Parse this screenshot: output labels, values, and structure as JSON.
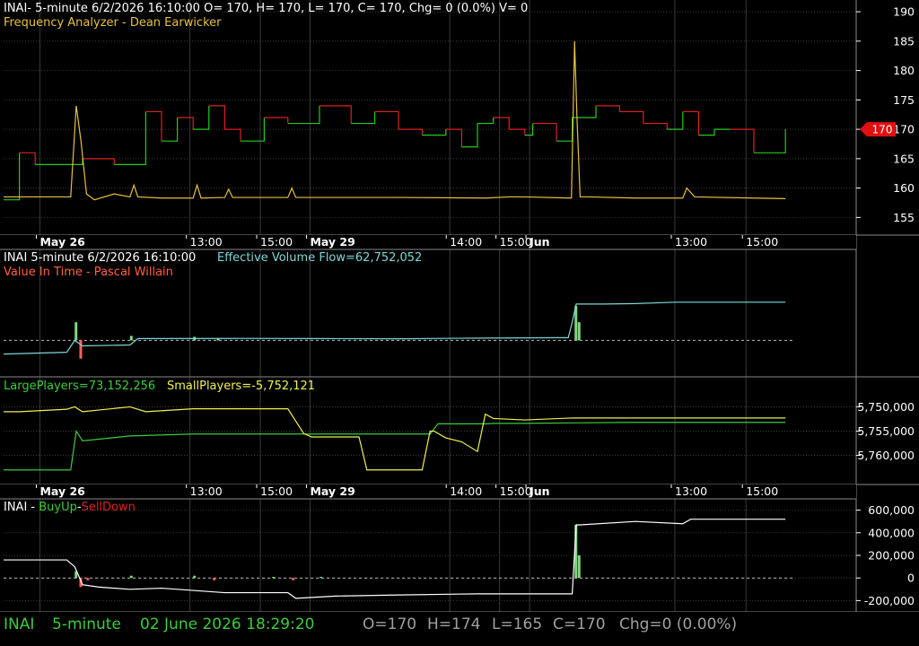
{
  "colors": {
    "background": "#000000",
    "grid": "#3a3a3a",
    "border": "#8a8a8a",
    "price_up": "#22cc22",
    "price_down": "#e02020",
    "freq": "#e8c040",
    "evf": "#7fd7d7",
    "large_players": "#3ccc3c",
    "small_players": "#f0f050",
    "buysell_line": "#ffffff",
    "buy_bar": "#7fd77f",
    "sell_bar": "#ff6060",
    "price_tag": "#e01010",
    "status_green": "#3ccc3c",
    "status_gray": "#a0a0a0"
  },
  "panel1": {
    "header": "INAI- 5-minute 6/2/2026 16:10:00 O= 170, H= 170, L= 170, C= 170, Chg= 0 (0.0%) V= 0",
    "subheader": "Frequency Analyzer - Dean Earwicker",
    "price_tag": "170"
  },
  "panel2": {
    "header_left": "INAI 5-minute  6/2/2026 16:10:00",
    "header_right": "Effective Volume Flow=62,752,052",
    "subheader": "Value In Time - Pascal Willain"
  },
  "panel3": {
    "large_label": "LargePlayers=73,152,256",
    "small_label": "SmallPlayers=-5,752,121"
  },
  "panel4": {
    "label_prefix": "INAI - ",
    "label_buy": "BuyUp",
    "label_sep": "-",
    "label_sell": "SellDown"
  },
  "time_axis": {
    "labels": [
      "May 26",
      "13:00",
      "15:00",
      "May 29",
      "14:00",
      "15:00",
      "Jun",
      "13:00",
      "15:00"
    ]
  },
  "status_bar": {
    "symbol": "INAI",
    "interval": "5-minute",
    "datetime": "02 June 2026 18:29:20",
    "open": "O=170",
    "high": "H=174",
    "low": "L=165",
    "close": "C=170",
    "change": "Chg=0 (0.00%)"
  },
  "chart_data": [
    {
      "type": "line",
      "panel": "price",
      "ylim": [
        152,
        192
      ],
      "yticks": [
        "190",
        "185",
        "180",
        "175",
        "170",
        "165",
        "160",
        "155"
      ],
      "series": [
        {
          "role": "price-steps",
          "x": [
            0,
            2,
            4,
            10,
            14,
            18,
            20,
            22,
            24,
            26,
            28,
            30,
            33,
            36,
            40,
            44,
            47,
            50,
            53,
            56,
            58,
            60,
            62,
            64,
            66,
            67,
            70,
            72,
            75,
            78,
            81,
            84,
            86,
            88,
            90,
            92,
            95,
            99
          ],
          "values": [
            158,
            166,
            164,
            165,
            164,
            173,
            168,
            172,
            170,
            174,
            170,
            168,
            172,
            171,
            174,
            171,
            173,
            170,
            169,
            170,
            167,
            171,
            172,
            170,
            169,
            171,
            168,
            172,
            174,
            173,
            171,
            170,
            173,
            169,
            170,
            170,
            166,
            170
          ]
        },
        {
          "role": "frequency-analyzer",
          "x": [
            0,
            8.5,
            9.2,
            9.8,
            10.5,
            11.5,
            14,
            16,
            16.5,
            17,
            20,
            24,
            24.5,
            25,
            28,
            28.5,
            29,
            36,
            36.5,
            37,
            50,
            61,
            64,
            66,
            71.9,
            72.3,
            72.6,
            73,
            74,
            80,
            86,
            86.5,
            87.5,
            95,
            99
          ],
          "values": [
            158.5,
            158.5,
            174,
            168,
            159,
            158,
            159,
            158.5,
            160.5,
            158.5,
            158.3,
            158.3,
            160.5,
            158.3,
            158.4,
            159.8,
            158.4,
            158.4,
            160,
            158.4,
            158.4,
            158.3,
            158.5,
            158.5,
            158.3,
            185,
            172,
            158.5,
            158.5,
            158.3,
            158.3,
            160,
            158.5,
            158.3,
            158.2
          ]
        }
      ]
    },
    {
      "type": "line",
      "panel": "evf",
      "ylim": [
        -40,
        100
      ],
      "zero_line": 0,
      "series": [
        {
          "name": "Effective Volume Flow",
          "x": [
            0,
            8,
            9,
            10,
            16,
            17,
            30,
            40,
            50,
            60,
            70,
            71.5,
            72,
            72.5,
            76,
            80,
            85,
            88,
            99
          ],
          "values": [
            -15,
            -13,
            0,
            -6,
            -5,
            2,
            2.2,
            2,
            1.8,
            2.5,
            3,
            3,
            20,
            40,
            40,
            40.5,
            42,
            42,
            42
          ]
        }
      ]
    },
    {
      "type": "line",
      "panel": "players",
      "yticks": [
        "5,750,000",
        "5,755,000",
        "5,760,000"
      ],
      "series": [
        {
          "name": "LargePlayers",
          "x": [
            0,
            8.5,
            9.2,
            10,
            16,
            24,
            28,
            36,
            38,
            42,
            50,
            54,
            55,
            56.5,
            60,
            61,
            62,
            66,
            72,
            80,
            99
          ],
          "values": [
            -9,
            -9,
            -1,
            -3,
            -2,
            -1.6,
            -1.6,
            -1.6,
            -1.6,
            -1.6,
            -1.6,
            -1.6,
            0.5,
            0.5,
            0.5,
            0.5,
            0.6,
            0.6,
            0.7,
            0.8,
            0.8
          ]
        },
        {
          "name": "SmallPlayers",
          "x": [
            0,
            2,
            8,
            9,
            10,
            16,
            18,
            24,
            28,
            36,
            38,
            39,
            42,
            45,
            46,
            47,
            50,
            53,
            54,
            54.5,
            56,
            58,
            60,
            61,
            62,
            66,
            72,
            80,
            99
          ],
          "values": [
            3,
            3,
            3.5,
            4,
            3,
            4,
            3,
            3.6,
            3.6,
            3.6,
            -1.5,
            -2.2,
            -2.2,
            -2.2,
            -9,
            -9,
            -9,
            -9,
            -1,
            -1,
            -2.4,
            -3.2,
            -5.2,
            2.5,
            1.6,
            1.3,
            1.7,
            1.7,
            1.7
          ]
        }
      ]
    },
    {
      "type": "line",
      "panel": "buysell",
      "ylim": [
        -300000,
        700000
      ],
      "yticks": [
        "600,000",
        "400,000",
        "200,000",
        "0",
        "-200,000"
      ],
      "series": [
        {
          "name": "BuyUp-SellDown",
          "x": [
            0,
            8,
            9,
            10,
            12,
            16,
            20,
            24,
            28,
            36,
            37,
            42,
            50,
            60,
            72,
            72.5,
            73,
            80,
            86,
            87,
            99
          ],
          "values": [
            160000,
            160000,
            100000,
            -60000,
            -80000,
            -100000,
            -90000,
            -110000,
            -130000,
            -130000,
            -180000,
            -160000,
            -150000,
            -140000,
            -140000,
            470000,
            470000,
            500000,
            480000,
            520000,
            520000
          ]
        }
      ]
    }
  ]
}
